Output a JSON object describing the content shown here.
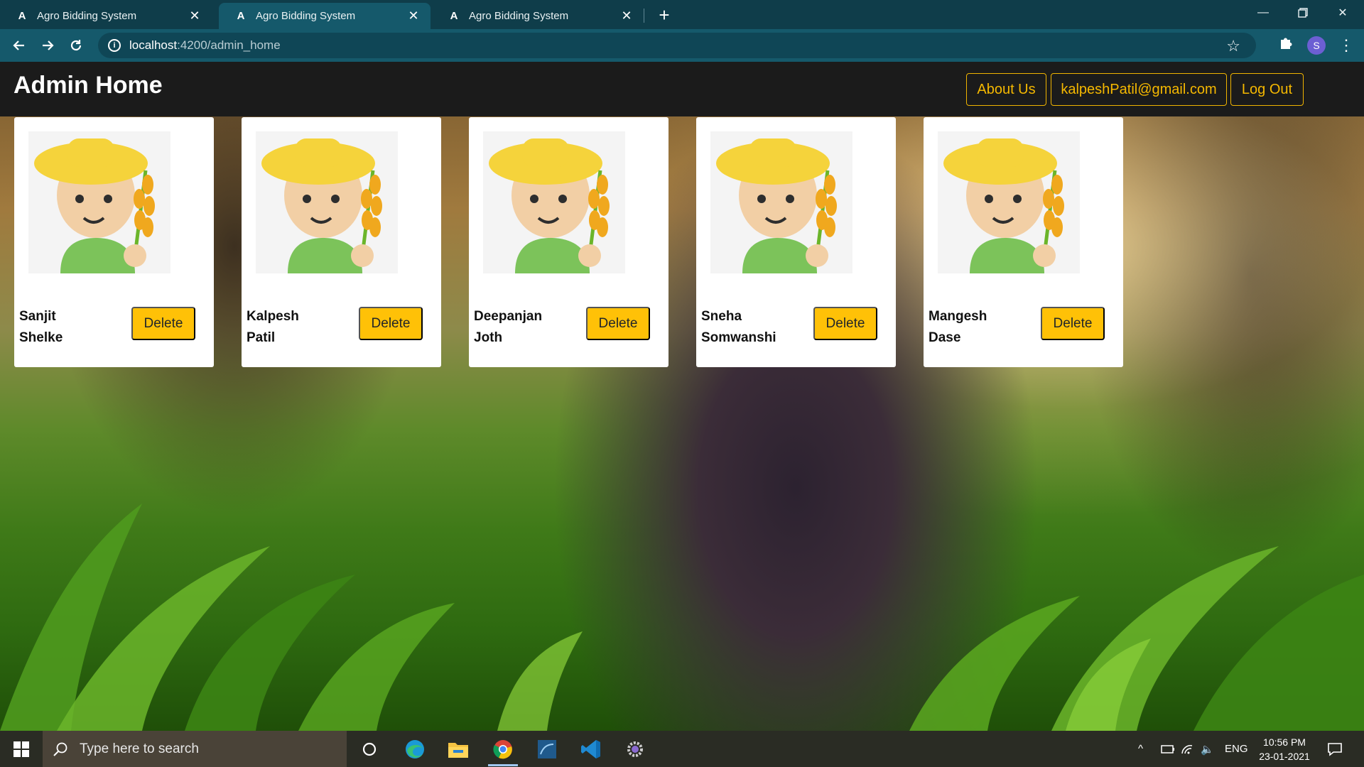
{
  "browser": {
    "tabs": [
      {
        "title": "Agro Bidding System",
        "active": false
      },
      {
        "title": "Agro Bidding System",
        "active": true
      },
      {
        "title": "Agro Bidding System",
        "active": false
      }
    ],
    "url_host": "localhost",
    "url_path": ":4200/admin_home",
    "profile_initial": "S"
  },
  "app": {
    "title": "Admin Home",
    "nav": {
      "about": "About Us",
      "email": "kalpeshPatil@gmail.com",
      "logout": "Log Out"
    },
    "delete_label": "Delete",
    "farmers": [
      {
        "first": "Sanjit",
        "last": "Shelke"
      },
      {
        "first": "Kalpesh",
        "last": "Patil"
      },
      {
        "first": "Deepanjan",
        "last": "Joth"
      },
      {
        "first": "Sneha",
        "last": "Somwanshi"
      },
      {
        "first": "Mangesh",
        "last": "Dase"
      }
    ]
  },
  "taskbar": {
    "search_placeholder": "Type here to search",
    "language": "ENG",
    "time": "10:56 PM",
    "date": "23-01-2021"
  },
  "colors": {
    "accent": "#ffc107",
    "navbar": "#1b1b1b",
    "chrome": "#15596b"
  }
}
